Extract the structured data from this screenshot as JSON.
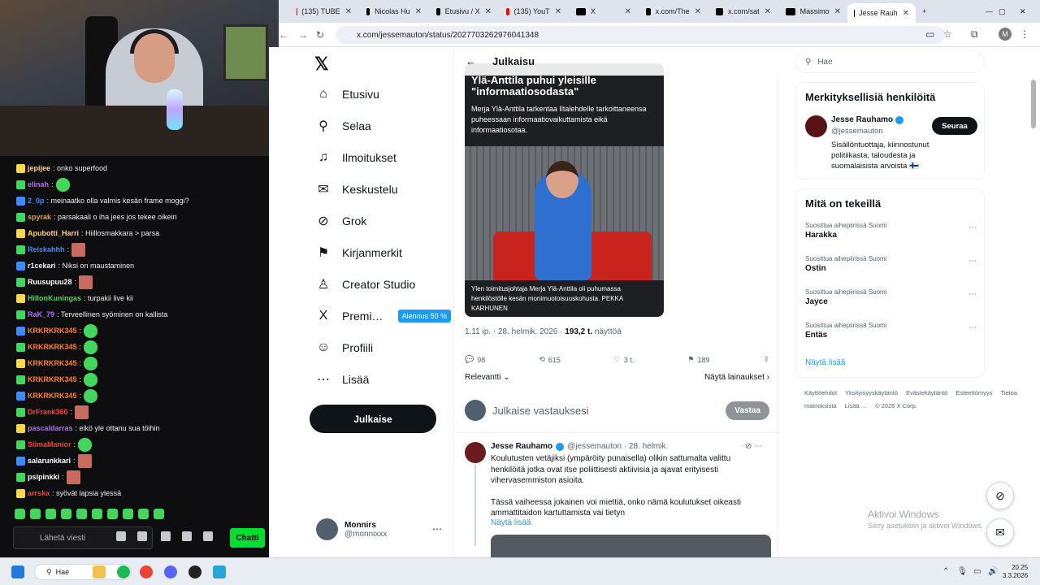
{
  "stream": {
    "chat": [
      {
        "user": "jepijee",
        "color": "#ffd84f",
        "text": ": onko superfood"
      },
      {
        "user": "elinah",
        "color": "#b06dff",
        "text": ":"
      },
      {
        "user": "2_0p",
        "color": "#3b8cff",
        "text": ": meinaatko olla valmis kesän frame moggi?"
      },
      {
        "user": "spyrak",
        "color": "#e8a33a",
        "text": ": parsakaali o iha jees jos tekee oikein"
      },
      {
        "user": "Apubotti_Harri",
        "color": "#ffd84f",
        "text": ": Hiillosmakkara > parsa"
      },
      {
        "user": "Reiskahhh",
        "color": "#3b8cff",
        "text": ":"
      },
      {
        "user": "r1cekari",
        "color": "#efeff1",
        "text": ": Niksi on maustaminen"
      },
      {
        "user": "Ruusupuu28",
        "color": "#ffffff",
        "text": ":"
      },
      {
        "user": "HillonKuningas",
        "color": "#42d65c",
        "text": ": turpakii live kii"
      },
      {
        "user": "RaK_79",
        "color": "#b06dff",
        "text": ": Terveellinen syöminen on kallista"
      },
      {
        "user": "KRKRKRK345",
        "color": "#ff7f2a",
        "text": ":"
      },
      {
        "user": "KRKRKRK345",
        "color": "#ff7f2a",
        "text": ":"
      },
      {
        "user": "KRKRKRK345",
        "color": "#ff7f2a",
        "text": ":"
      },
      {
        "user": "KRKRKRK345",
        "color": "#ff7f2a",
        "text": ":"
      },
      {
        "user": "KRKRKRK345",
        "color": "#ff7f2a",
        "text": ":"
      },
      {
        "user": "DrFrank360",
        "color": "#ff4040",
        "text": ":"
      },
      {
        "user": "pascaldarras",
        "color": "#b06dff",
        "text": ": eikö yle ottanu sua töihin"
      },
      {
        "user": "SiimaManior",
        "color": "#ff3b3b",
        "text": ":"
      },
      {
        "user": "salarunkkari",
        "color": "#ffffff",
        "text": ":"
      },
      {
        "user": "psipinkki",
        "color": "#ffffff",
        "text": ":"
      },
      {
        "user": "arrska",
        "color": "#ff3b3b",
        "text": ": syövät lapsia ylessä"
      }
    ],
    "chat_placeholder": "Lähetä viesti",
    "chat_button": "Chatti"
  },
  "browser": {
    "tabs": [
      {
        "label": "(135) TUBE",
        "icon_color": "#ff0000"
      },
      {
        "label": "Nicolas Hu",
        "icon_color": "#000000"
      },
      {
        "label": "Etusivu / X",
        "icon_color": "#000000"
      },
      {
        "label": "(135) YouT",
        "icon_color": "#ff0000"
      },
      {
        "label": "X",
        "icon_color": "#000000"
      },
      {
        "label": "x.com/The",
        "icon_color": "#000000"
      },
      {
        "label": "x.com/sat",
        "icon_color": "#000000"
      },
      {
        "label": "Massimo",
        "icon_color": "#000000"
      },
      {
        "label": "Jesse Rauh",
        "icon_color": "#000000"
      }
    ],
    "url": "x.com/jessemauton/status/2027703262976041348",
    "profile_initial": "M"
  },
  "x": {
    "nav": [
      {
        "label": "Etusivu",
        "icon": "⌂"
      },
      {
        "label": "Selaa",
        "icon": "⚲"
      },
      {
        "label": "Ilmoitukset",
        "icon": "♫"
      },
      {
        "label": "Keskustelu",
        "icon": "✉"
      },
      {
        "label": "Grok",
        "icon": "⊘"
      },
      {
        "label": "Kirjanmerkit",
        "icon": "⚑"
      },
      {
        "label": "Creator Studio",
        "icon": "♙"
      },
      {
        "label": "Premi…",
        "icon": "X"
      },
      {
        "label": "Profiili",
        "icon": "☺"
      },
      {
        "label": "Lisää",
        "icon": "⋯"
      }
    ],
    "premium_badge": "Alennus 50 %",
    "post_button": "Julkaise",
    "account": {
      "name": "Monnirs",
      "handle": "@monnixxx"
    },
    "header_title": "Julkaisu",
    "news": {
      "headline": "Ylä-Anttila puhui yleisille \"informaatiosodasta\"",
      "sub": "Merja Ylä-Anttila tarkentaa Iltalehdelle tarkoittaneensa puheessaan informaatiovaikuttamista eikä informaatiosotaa.",
      "caption": "Ylen toimitusjohtaja Merja Ylä-Anttila oli puhumassa henkilöstölle kesän monimuotoisuuskohusta. PEKKA KARHUNEN"
    },
    "post_time": "1.11 ip. · 28. helmik. 2026 · ",
    "views": "193,2 t.",
    "views_label": " näyttöä",
    "stats": {
      "replies": "98",
      "reposts": "615",
      "likes": "3 t.",
      "bookmarks": "189"
    },
    "sort_label": "Relevantti",
    "quotes_label": "Näytä lainaukset",
    "reply_placeholder": "Julkaise vastauksesi",
    "reply_button": "Vastaa",
    "reply": {
      "name": "Jesse Rauhamo",
      "handle": "@jessemauton · 28. helmik.",
      "text1": "Koulutusten vetäjiksi (ympäröity punaisella) olikin sattumalta valittu henkilöitä jotka ovat itse poliittisesti aktiivisia ja ajavat erityisesti vihervasemmiston asioita.",
      "text2": "Tässä vaiheessa jokainen voi miettiä, onko nämä koulutukset oikeasti ammattitaidon kartuttamista vai tietyn",
      "show_more": "Näytä lisää"
    },
    "search_placeholder": "Hae",
    "relevant": {
      "title": "Merkityksellisiä henkilöitä",
      "name": "Jesse Rauhamo",
      "handle": "@jessemauton",
      "bio": "Sisällöntuottaja, kiinnostunut politiikasta, taloudesta ja suomalaisista arvoista 🇫🇮",
      "follow": "Seuraa"
    },
    "trends_title": "Mitä on tekeillä",
    "trends": [
      {
        "category": "Suosittua aihepiirissä Suomi",
        "name": "Harakka"
      },
      {
        "category": "Suosittua aihepiirissä Suomi",
        "name": "Ostin"
      },
      {
        "category": "Suosittua aihepiirissä Suomi",
        "name": "Jayce"
      },
      {
        "category": "Suosittua aihepiirissä Suomi",
        "name": "Entäs"
      }
    ],
    "trends_more": "Näytä lisää",
    "footer": [
      "Käyttöehdot",
      "Yksityisyyskäytäntö",
      "Evästekäytäntö",
      "Esteettömyys",
      "Tietoa mainoksista",
      "Lisää …",
      "© 2026 X Corp."
    ],
    "watermark_title": "Aktivoi Windows",
    "watermark_sub": "Siirry asetuksiin ja aktivoi Windows."
  },
  "taskbar": {
    "search": "Hae",
    "time": "20.25",
    "date": "3.3.2026"
  }
}
